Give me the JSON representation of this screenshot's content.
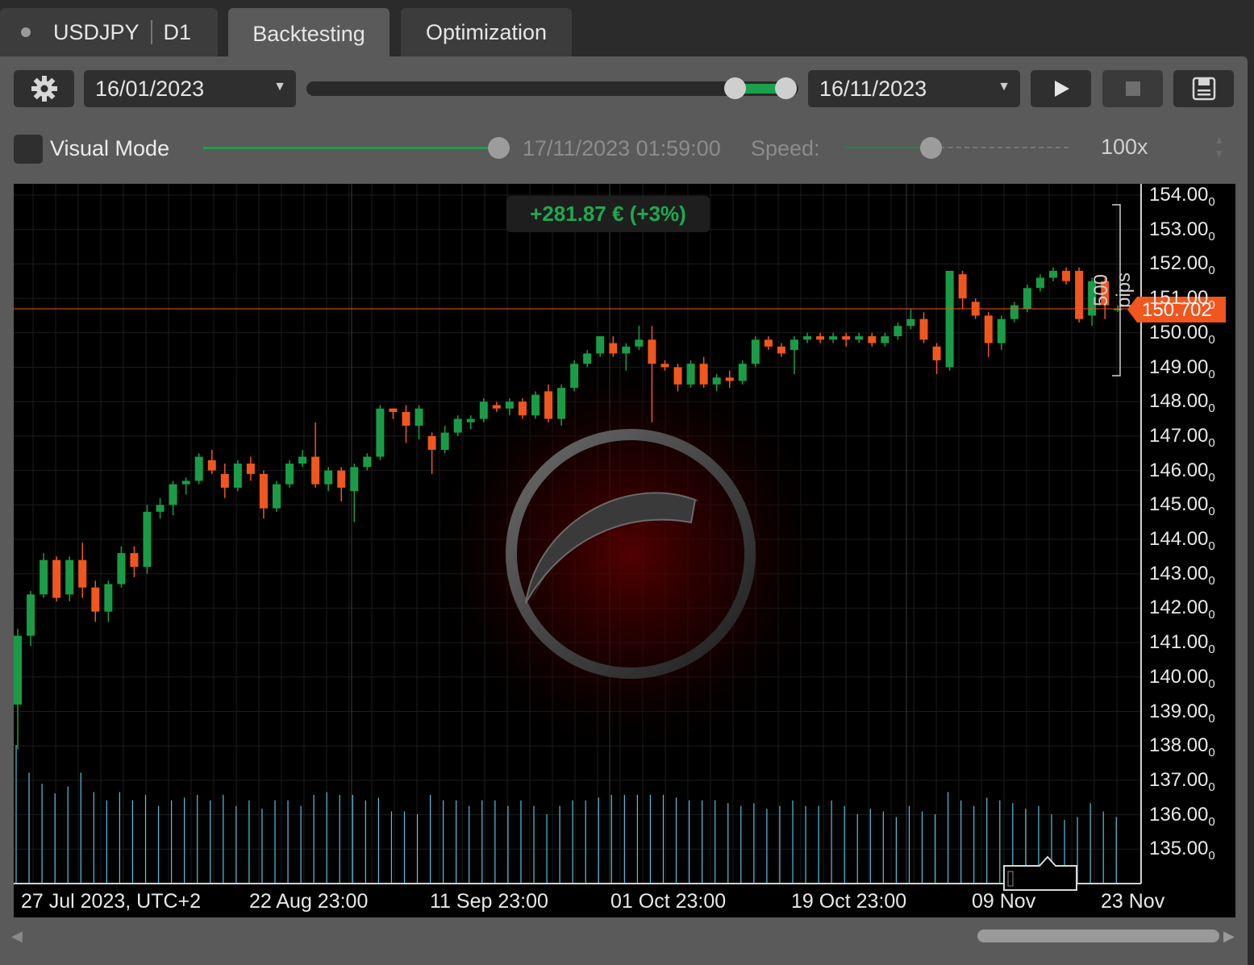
{
  "tabs": {
    "symbol": "USDJPY",
    "timeframe": "D1",
    "backtesting": "Backtesting",
    "optimization": "Optimization"
  },
  "toolbar": {
    "start_date": "16/01/2023",
    "end_date": "16/11/2023"
  },
  "visual": {
    "label": "Visual Mode",
    "timestamp": "17/11/2023 01:59:00",
    "speed_label": "Speed:",
    "speed_value": "100x"
  },
  "chart": {
    "pnl": "+281.87 € (+3%)",
    "pips_label": "500 pips",
    "current_price": "150.702",
    "y_labels": [
      "154.00",
      "153.00",
      "152.00",
      "151.00",
      "150.00",
      "149.00",
      "148.00",
      "147.00",
      "146.00",
      "145.00",
      "144.00",
      "143.00",
      "142.00",
      "141.00",
      "140.00",
      "139.00",
      "138.00",
      "137.00",
      "136.00",
      "135.00"
    ],
    "y_suffix": "0",
    "x_labels": [
      "27 Jul 2023, UTC+2",
      "22 Aug 23:00",
      "11 Sep 23:00",
      "01 Oct 23:00",
      "19 Oct 23:00",
      "09 Nov",
      "23 Nov"
    ],
    "up_color": "#1a9c46",
    "down_color": "#f0561d",
    "volume_color": "#5bc0de",
    "price_line_color": "#f0561d"
  },
  "chart_data": {
    "type": "candlestick",
    "ylim": [
      134,
      154.3
    ],
    "candles": [
      [
        139.2,
        141.2,
        137.9,
        141.4
      ],
      [
        141.2,
        142.4,
        140.9,
        142.5
      ],
      [
        142.4,
        143.4,
        142.3,
        143.6
      ],
      [
        143.4,
        142.3,
        142.2,
        143.5
      ],
      [
        142.4,
        143.4,
        142.2,
        143.5
      ],
      [
        143.4,
        142.6,
        142.3,
        143.9
      ],
      [
        142.6,
        141.9,
        141.6,
        142.8
      ],
      [
        141.9,
        142.7,
        141.6,
        142.8
      ],
      [
        142.7,
        143.6,
        142.6,
        143.8
      ],
      [
        143.6,
        143.2,
        142.9,
        143.8
      ],
      [
        143.2,
        144.8,
        143.0,
        145.0
      ],
      [
        144.8,
        145.0,
        144.6,
        145.2
      ],
      [
        145.0,
        145.6,
        144.7,
        145.7
      ],
      [
        145.6,
        145.7,
        145.3,
        145.8
      ],
      [
        145.7,
        146.4,
        145.6,
        146.5
      ],
      [
        146.3,
        146.0,
        145.9,
        146.6
      ],
      [
        145.9,
        145.5,
        145.2,
        146.2
      ],
      [
        145.5,
        146.2,
        145.4,
        146.3
      ],
      [
        146.2,
        145.9,
        145.7,
        146.4
      ],
      [
        145.9,
        144.9,
        144.6,
        146.0
      ],
      [
        144.9,
        145.6,
        144.8,
        145.7
      ],
      [
        145.6,
        146.2,
        145.5,
        146.3
      ],
      [
        146.2,
        146.4,
        146.1,
        146.6
      ],
      [
        146.4,
        145.6,
        145.5,
        147.4
      ],
      [
        145.6,
        146.0,
        145.4,
        146.1
      ],
      [
        146.0,
        145.5,
        145.1,
        146.1
      ],
      [
        145.4,
        146.1,
        144.5,
        146.2
      ],
      [
        146.1,
        146.4,
        146.0,
        146.5
      ],
      [
        146.4,
        147.8,
        146.3,
        147.9
      ],
      [
        147.8,
        147.7,
        147.5,
        147.8
      ],
      [
        147.7,
        147.3,
        146.8,
        147.9
      ],
      [
        147.3,
        147.8,
        146.9,
        147.9
      ],
      [
        147.0,
        146.6,
        145.9,
        147.1
      ],
      [
        146.6,
        147.1,
        146.5,
        147.3
      ],
      [
        147.1,
        147.5,
        147.0,
        147.6
      ],
      [
        147.4,
        147.5,
        147.2,
        147.6
      ],
      [
        147.5,
        148.0,
        147.4,
        148.1
      ],
      [
        147.9,
        147.8,
        147.7,
        148.0
      ],
      [
        147.8,
        148.0,
        147.6,
        148.1
      ],
      [
        148.0,
        147.6,
        147.5,
        148.1
      ],
      [
        147.6,
        148.2,
        147.5,
        148.3
      ],
      [
        148.3,
        147.5,
        147.4,
        148.5
      ],
      [
        147.5,
        148.4,
        147.3,
        148.5
      ],
      [
        148.4,
        149.1,
        148.3,
        149.2
      ],
      [
        149.1,
        149.4,
        149.0,
        149.5
      ],
      [
        149.4,
        149.9,
        149.3,
        149.9
      ],
      [
        149.7,
        149.4,
        149.3,
        149.9
      ],
      [
        149.4,
        149.6,
        148.9,
        149.7
      ],
      [
        149.6,
        149.8,
        149.5,
        150.2
      ],
      [
        149.8,
        149.1,
        147.4,
        150.2
      ],
      [
        149.1,
        149.0,
        148.9,
        149.2
      ],
      [
        149.0,
        148.5,
        148.3,
        149.1
      ],
      [
        148.5,
        149.1,
        148.4,
        149.2
      ],
      [
        149.1,
        148.5,
        148.4,
        149.3
      ],
      [
        148.5,
        148.7,
        148.3,
        148.8
      ],
      [
        148.7,
        148.6,
        148.4,
        148.9
      ],
      [
        148.6,
        149.1,
        148.5,
        149.2
      ],
      [
        149.1,
        149.8,
        149.0,
        149.9
      ],
      [
        149.8,
        149.6,
        149.5,
        149.9
      ],
      [
        149.6,
        149.4,
        149.3,
        149.7
      ],
      [
        149.5,
        149.8,
        148.8,
        149.9
      ],
      [
        149.8,
        149.9,
        149.7,
        150.0
      ],
      [
        149.9,
        149.8,
        149.7,
        150.0
      ],
      [
        149.8,
        149.9,
        149.7,
        150.0
      ],
      [
        149.9,
        149.8,
        149.6,
        150.0
      ],
      [
        149.8,
        149.9,
        149.7,
        150.0
      ],
      [
        149.9,
        149.7,
        149.6,
        150.0
      ],
      [
        149.7,
        149.9,
        149.6,
        150.0
      ],
      [
        149.9,
        150.2,
        149.8,
        150.3
      ],
      [
        150.2,
        150.4,
        150.1,
        150.7
      ],
      [
        150.4,
        149.8,
        149.7,
        150.6
      ],
      [
        149.6,
        149.2,
        148.8,
        149.7
      ],
      [
        149.0,
        151.8,
        148.9,
        151.8
      ],
      [
        151.7,
        151.0,
        150.7,
        151.8
      ],
      [
        150.9,
        150.5,
        150.4,
        151.0
      ],
      [
        150.5,
        149.7,
        149.3,
        150.6
      ],
      [
        149.7,
        150.4,
        149.5,
        150.5
      ],
      [
        150.4,
        150.8,
        150.3,
        150.9
      ],
      [
        150.7,
        151.3,
        150.6,
        151.4
      ],
      [
        151.3,
        151.6,
        151.2,
        151.7
      ],
      [
        151.6,
        151.8,
        151.5,
        151.9
      ],
      [
        151.8,
        151.5,
        151.4,
        151.9
      ],
      [
        151.8,
        150.4,
        150.3,
        151.9
      ],
      [
        150.5,
        151.5,
        150.2,
        151.6
      ],
      [
        151.5,
        150.8,
        150.4,
        151.6
      ],
      [
        150.7,
        150.7,
        150.6,
        150.8
      ]
    ],
    "volumes": [
      1,
      0.8,
      0.72,
      0.65,
      0.7,
      0.8,
      0.66,
      0.6,
      0.66,
      0.6,
      0.64,
      0.56,
      0.6,
      0.62,
      0.64,
      0.6,
      0.64,
      0.56,
      0.6,
      0.54,
      0.6,
      0.6,
      0.56,
      0.64,
      0.66,
      0.64,
      0.64,
      0.6,
      0.62,
      0.52,
      0.52,
      0.5,
      0.64,
      0.6,
      0.6,
      0.56,
      0.6,
      0.6,
      0.56,
      0.6,
      0.56,
      0.5,
      0.56,
      0.6,
      0.6,
      0.62,
      0.64,
      0.64,
      0.64,
      0.64,
      0.64,
      0.62,
      0.6,
      0.6,
      0.6,
      0.58,
      0.56,
      0.58,
      0.54,
      0.56,
      0.6,
      0.56,
      0.56,
      0.6,
      0.56,
      0.5,
      0.54,
      0.52,
      0.48,
      0.56,
      0.52,
      0.5,
      0.66,
      0.6,
      0.56,
      0.62,
      0.6,
      0.58,
      0.54,
      0.56,
      0.5,
      0.46,
      0.48,
      0.58,
      0.52,
      0.48
    ]
  }
}
